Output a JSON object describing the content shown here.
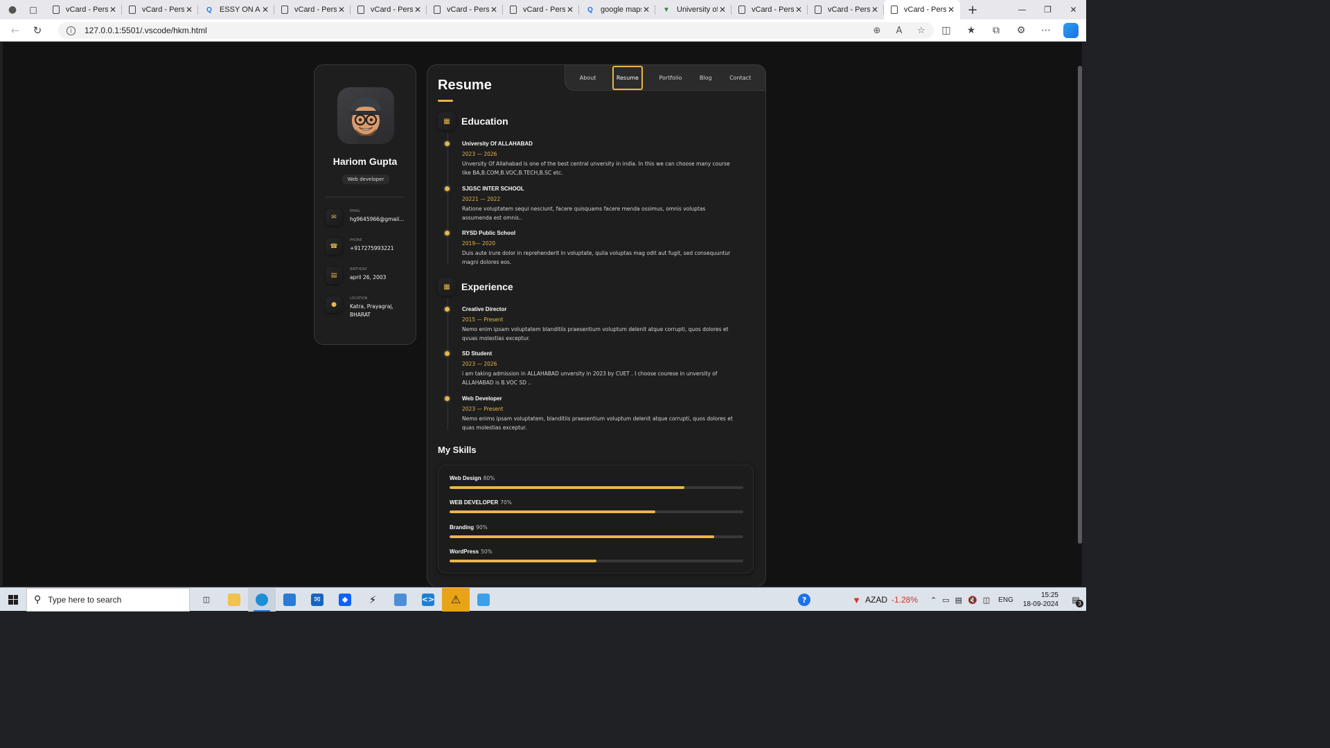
{
  "browser": {
    "tabs": [
      {
        "title": "vCard - Perso",
        "icon": "document-icon"
      },
      {
        "title": "vCard - Perso",
        "icon": "document-icon"
      },
      {
        "title": "ESSY ON ALL",
        "icon": "search-icon"
      },
      {
        "title": "vCard - Perso",
        "icon": "document-icon"
      },
      {
        "title": "vCard - Perso",
        "icon": "document-icon"
      },
      {
        "title": "vCard - Perso",
        "icon": "document-icon"
      },
      {
        "title": "vCard - Perso",
        "icon": "document-icon"
      },
      {
        "title": "google maps",
        "icon": "search-icon"
      },
      {
        "title": "University of",
        "icon": "map-pin-icon"
      },
      {
        "title": "vCard - Perso",
        "icon": "document-icon"
      },
      {
        "title": "vCard - Perso",
        "icon": "document-icon"
      },
      {
        "title": "vCard - Perso",
        "icon": "document-icon"
      }
    ],
    "active_tab_index": 11,
    "url": "127.0.0.1:5501/.vscode/hkm.html"
  },
  "profile": {
    "name": "Hariom Gupta",
    "title": "Web developer",
    "contacts": [
      {
        "label": "EMAIL",
        "value": "hg9645966@gmail...",
        "icon": "mail-icon"
      },
      {
        "label": "PHONE",
        "value": "+917275993221",
        "icon": "phone-icon"
      },
      {
        "label": "BIRTHDAY",
        "value": "april 26, 2003",
        "icon": "calendar-icon"
      },
      {
        "label": "LOCATION",
        "value": "Katra, Prayagraj, BHARAT",
        "icon": "location-icon"
      }
    ]
  },
  "nav": {
    "links": [
      "About",
      "Resume",
      "Portfolio",
      "Blog",
      "Contact"
    ],
    "active": "Resume"
  },
  "resume": {
    "heading": "Resume",
    "education": {
      "title": "Education",
      "items": [
        {
          "title": "University Of ALLAHABAD",
          "date": "2023 — 2026",
          "text": "Unversity Of Allahabad is one of the best central unversity in india. In this we can choose many course like BA,B.COM,B.VOC,B.TECH,B.SC etc."
        },
        {
          "title": "SJGSC INTER SCHOOL",
          "date": "20221 — 2022",
          "text": "Ratione voluptatem sequi nesciunt, facere quisquams facere menda ossimus, omnis voluptas assumenda est omnis.."
        },
        {
          "title": "RYSD Public School",
          "date": "2019— 2020",
          "text": "Duis aute irure dolor in reprehenderit in voluptate, quila voluptas mag odit aut fugit, sed consequuntur magni dolores eos."
        }
      ]
    },
    "experience": {
      "title": "Experience",
      "items": [
        {
          "title": "Creative Director",
          "date": "2015 — Present",
          "text": "Nemo enim ipsam voluptatem blanditiis praesentium voluptum delenit atque corrupti, quos dolores et qvuas molestias exceptur."
        },
        {
          "title": "SD Student",
          "date": "2023 — 2026",
          "text": "i am taking admission in ALLAHABAD unversity in 2023 by CUET . I choose courese in unversity of ALLAHABAD is B.VOC SD .."
        },
        {
          "title": "Web Developer",
          "date": "2023 — Present",
          "text": "Nemo enims ipsam voluptatem, blanditiis praesentium voluptum delenit atque corrupti, quos dolores et quas molestias exceptur."
        }
      ]
    },
    "skills": {
      "title": "My Skills",
      "items": [
        {
          "name": "Web Design",
          "percent_label": "80%",
          "value": 80
        },
        {
          "name": "WEB DEVELOPER",
          "percent_label": "70%",
          "value": 70
        },
        {
          "name": "Branding",
          "percent_label": "90%",
          "value": 90
        },
        {
          "name": "WordPress",
          "percent_label": "50%",
          "value": 50
        }
      ]
    }
  },
  "taskbar": {
    "search_placeholder": "Type here to search",
    "stock_name": "AZAD",
    "stock_change": "-1.28%",
    "language": "ENG",
    "time": "15:25",
    "date": "18-09-2024",
    "notification_count": "3"
  },
  "colors": {
    "accent": "#e8b64a",
    "page_bg": "#121212",
    "card_bg": "#1e1e1f"
  }
}
